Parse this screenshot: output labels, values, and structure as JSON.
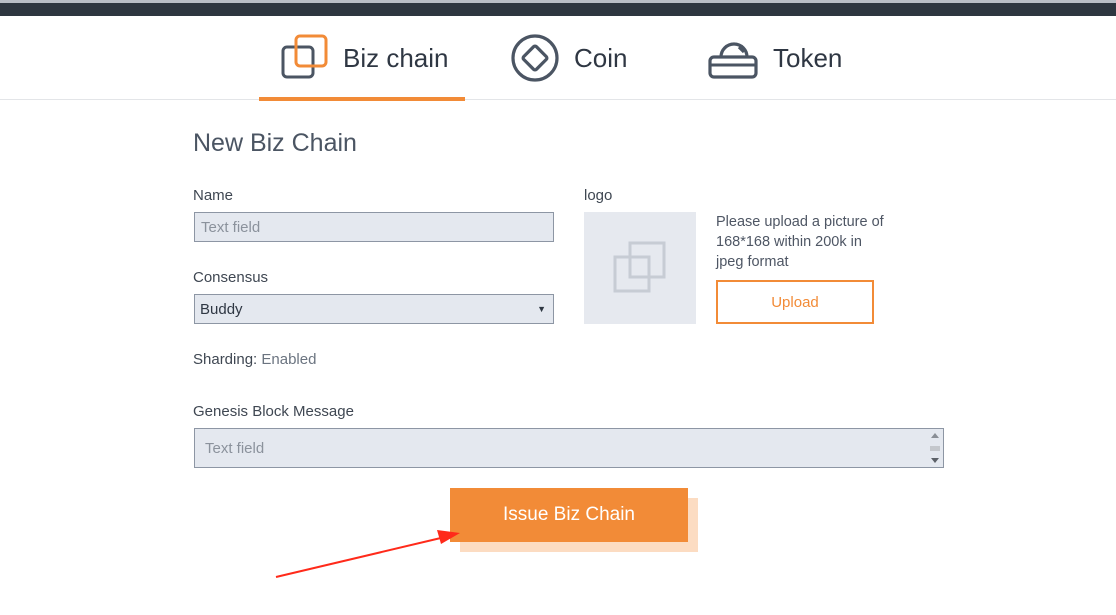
{
  "tabs": [
    {
      "label": "Biz chain",
      "icon": "biz-chain-icon",
      "active": true
    },
    {
      "label": "Coin",
      "icon": "coin-icon",
      "active": false
    },
    {
      "label": "Token",
      "icon": "token-icon",
      "active": false
    }
  ],
  "page_title": "New Biz Chain",
  "form": {
    "name_label": "Name",
    "name_placeholder": "Text field",
    "consensus_label": "Consensus",
    "consensus_value": "Buddy",
    "sharding_label": "Sharding:",
    "sharding_value": "Enabled",
    "genesis_label": "Genesis Block Message",
    "genesis_placeholder": "Text field",
    "logo_label": "logo",
    "logo_hint": "Please upload a picture of 168*168 within 200k in jpeg format",
    "upload_label": "Upload",
    "submit_label": "Issue Biz Chain"
  },
  "colors": {
    "accent": "#f28b37",
    "annotation_arrow": "#ff2a1a",
    "field_bg": "#e4e8ef"
  }
}
